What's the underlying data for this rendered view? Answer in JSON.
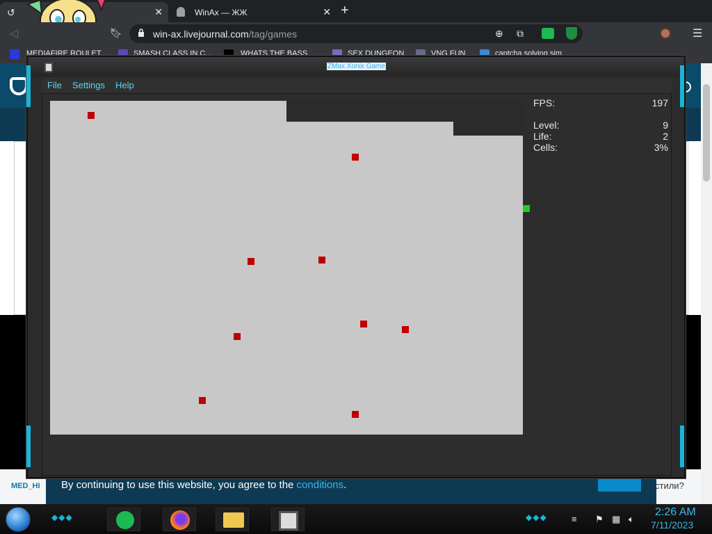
{
  "browser": {
    "tabs": [
      {
        "title": "",
        "close": "✕"
      },
      {
        "title": "WinAx — ЖЖ",
        "close": "✕"
      }
    ],
    "new_tab": "+",
    "url_host": "win-ax.livejournal.com",
    "url_path": "/tag/games",
    "bookmarks": [
      {
        "label": "MEDIAFIRE ROULET...",
        "icon_color": "#2a3ad8"
      },
      {
        "label": "SMASH CLASS IN C...",
        "icon_color": "#5a4ab8"
      },
      {
        "label": "WHATS THE BASS",
        "icon_color": "#000000"
      },
      {
        "label": "SEX DUNGEON",
        "icon_color": "#7a6ab8"
      },
      {
        "label": "VNG FUN",
        "icon_color": "#6a6a8a"
      },
      {
        "label": "captcha solving sim",
        "icon_color": "#3a8ad8"
      }
    ]
  },
  "website": {
    "cookie_text": "By continuing to use this website, you agree to the ",
    "cookie_link": "conditions",
    "cookie_end": ".",
    "footer_left": "MED_HI",
    "footer_right": "стили?"
  },
  "game": {
    "window_title": "ZMax Xonix Game",
    "menu": [
      "File",
      "Settings",
      "Help"
    ],
    "stats": {
      "fps_label": "FPS:",
      "fps": "197",
      "level_label": "Level:",
      "level": "9",
      "life_label": "Life:",
      "life": "2",
      "cells_label": "Cells:",
      "cells": "3%"
    },
    "colors": {
      "field": "#c8c8c8",
      "enemy": "#c00000",
      "player": "#1fcf1f",
      "border": "#2b2b2b"
    }
  },
  "taskbar": {
    "apps": [
      "spotify",
      "firefox",
      "file-explorer",
      "xonix"
    ],
    "time": "2:26 AM",
    "date": "7/11/2023"
  }
}
